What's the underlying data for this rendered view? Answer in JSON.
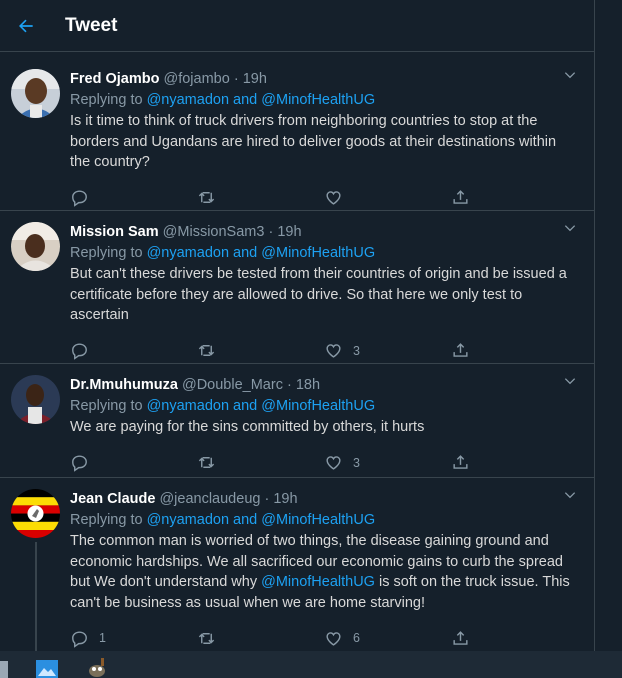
{
  "header": {
    "title": "Tweet"
  },
  "tweets": [
    {
      "name": "Fred Ojambo",
      "handle": "@fojambo",
      "sep": "·",
      "time": "19h",
      "replying_prefix": "Replying to ",
      "replying_user": "@nyamadon",
      "replying_and": " and ",
      "replying_user2": "@MinofHealthUG",
      "text": "Is it time to think of truck drivers from neighboring countries to stop at the borders and Ugandans are hired to deliver goods at their destinations within the country?",
      "replies": "",
      "retweets": "",
      "likes": ""
    },
    {
      "name": "Mission Sam",
      "handle": "@MissionSam3",
      "sep": "·",
      "time": "19h",
      "replying_prefix": "Replying to ",
      "replying_user": "@nyamadon",
      "replying_and": " and ",
      "replying_user2": "@MinofHealthUG",
      "text": "But can't these drivers be tested from their countries of origin and be issued a certificate before they are allowed to drive. So that here we only test to ascertain",
      "replies": "",
      "retweets": "",
      "likes": "3"
    },
    {
      "name": "Dr.Mmuhumuza",
      "handle": "@Double_Marc",
      "sep": "·",
      "time": "18h",
      "replying_prefix": "Replying to ",
      "replying_user": "@nyamadon",
      "replying_and": " and ",
      "replying_user2": "@MinofHealthUG",
      "text": "We are paying for the sins committed by others, it hurts",
      "replies": "",
      "retweets": "",
      "likes": "3"
    },
    {
      "name": "Jean Claude",
      "handle": "@jeanclaudeug",
      "sep": "·",
      "time": "19h",
      "replying_prefix": "Replying to ",
      "replying_user": "@nyamadon",
      "replying_and": " and ",
      "replying_user2": "@MinofHealthUG",
      "text_part1": "The common man is worried of two things, the disease gaining ground and economic hardships. We all sacrificed our economic gains to curb the spread but We don't understand why ",
      "text_mention": "@MinofHealthUG",
      "text_part2": " is soft on the truck issue. This can't be business as usual when we are home starving!",
      "replies": "1",
      "retweets": "",
      "likes": "6"
    }
  ],
  "colors": {
    "background": "#15202b",
    "accent": "#1da1f2",
    "border": "#38444d",
    "muted": "#8899a6"
  },
  "icons": [
    "back-arrow-icon",
    "chevron-down-icon",
    "reply-icon",
    "retweet-icon",
    "like-icon",
    "share-icon"
  ]
}
